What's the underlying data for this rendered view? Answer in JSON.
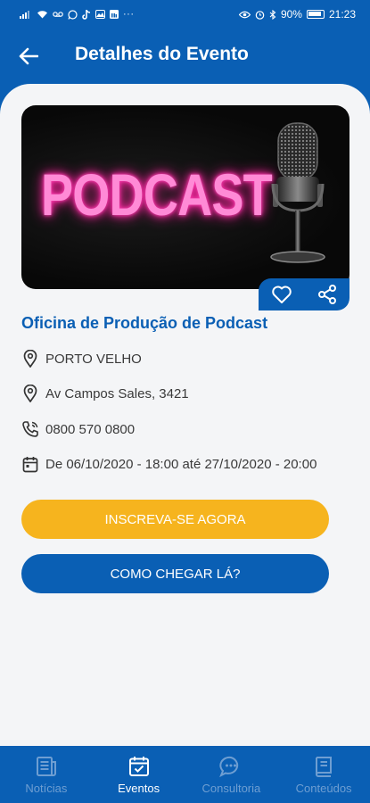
{
  "status_bar": {
    "battery": "90%",
    "time": "21:23",
    "icons_left": [
      "signal-icon",
      "wifi-icon",
      "voicemail-icon",
      "whatsapp-icon",
      "tiktok-icon",
      "gallery-icon",
      "linkedin-icon",
      "more-icon"
    ],
    "more": "···"
  },
  "header": {
    "title": "Detalhes do Evento"
  },
  "banner": {
    "text": "PODCAST"
  },
  "event": {
    "title": "Oficina de Produção de Podcast",
    "city": "PORTO VELHO",
    "address": "Av Campos Sales, 3421",
    "phone": "0800 570 0800",
    "dates": "De 06/10/2020 - 18:00 até 27/10/2020 - 20:00"
  },
  "buttons": {
    "register": "INSCREVA-SE AGORA",
    "directions": "COMO CHEGAR LÁ?"
  },
  "nav": [
    {
      "label": "Notícias",
      "icon": "newspaper-icon",
      "active": false
    },
    {
      "label": "Eventos",
      "icon": "calendar-check-icon",
      "active": true
    },
    {
      "label": "Consultoria",
      "icon": "chat-icon",
      "active": false
    },
    {
      "label": "Conteúdos",
      "icon": "book-icon",
      "active": false
    }
  ],
  "colors": {
    "primary": "#0a5fb4",
    "accent": "#f6b41e",
    "background": "#f4f5f7",
    "nav_inactive": "#6e9ed2"
  }
}
